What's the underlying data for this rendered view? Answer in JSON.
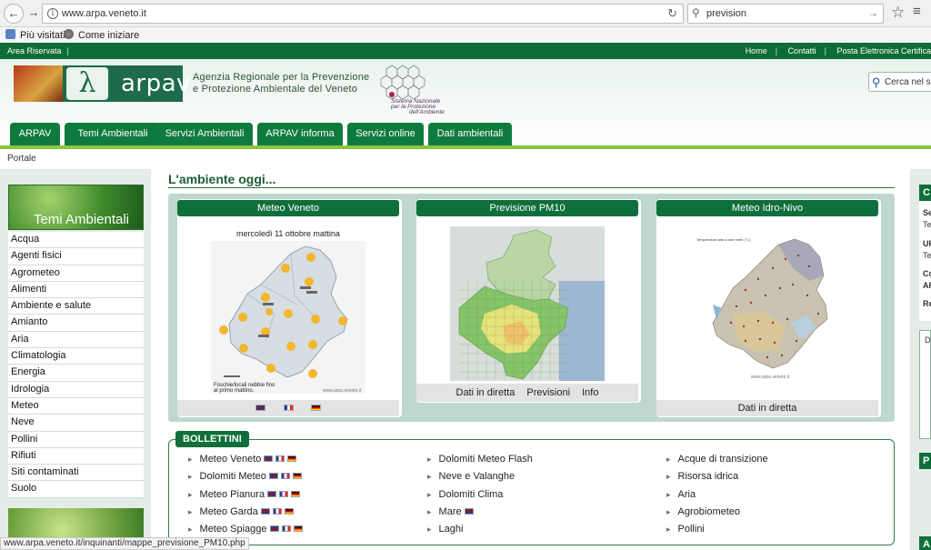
{
  "browser": {
    "url": "www.arpa.veneto.it",
    "search_value": "prevision",
    "bookmarks": [
      "Più visitati",
      "Come iniziare"
    ]
  },
  "topbar": {
    "area": "Area Riservata",
    "links": [
      "Home",
      "Contatti",
      "Posta Elettronica Certifica"
    ]
  },
  "header": {
    "brand": "arpav",
    "agency_line1": "Agenzia Regionale per la Prevenzione",
    "agency_line2": "e Protezione Ambientale del Veneto",
    "snpa_line1": "Sistema Nazionale",
    "snpa_line2": "per la Protezione",
    "snpa_line3": "dell'Ambiente",
    "search_placeholder": "Cerca nel sito"
  },
  "tabs": [
    "ARPAV",
    "Temi Ambientali",
    "Servizi Ambientali",
    "ARPAV informa",
    "Servizi online",
    "Dati ambientali"
  ],
  "breadcrumb": "Portale",
  "sidebar": {
    "banner_title": "Temi Ambientali",
    "items": [
      "Acqua",
      "Agenti fisici",
      "Agrometeo",
      "Alimenti",
      "Ambiente e salute",
      "Amianto",
      "Aria",
      "Climatologia",
      "Energia",
      "Idrologia",
      "Meteo",
      "Neve",
      "Pollini",
      "Rifiuti",
      "Siti contaminati",
      "Suolo"
    ]
  },
  "main": {
    "title": "L'ambiente oggi...",
    "cards": {
      "meteo": {
        "title": "Meteo Veneto",
        "caption": "mercoledì 11 ottobre  mattina",
        "note": "Foschie/locali nebbie fino al primo mattino.",
        "credit": "www.arpa.veneto.it"
      },
      "pm10": {
        "title": "Previsione PM10",
        "links": [
          "Dati in diretta",
          "Previsioni",
          "Info"
        ]
      },
      "idro": {
        "title": "Meteo Idro-Nivo",
        "link": "Dati in diretta",
        "map_title": "Temperatura aria a due metri (°C)",
        "credit": "www.arpa.veneto.it"
      }
    }
  },
  "bollettini": {
    "title": "BOLLETTINI",
    "col1": [
      "Meteo Veneto",
      "Dolomiti Meteo",
      "Meteo Pianura",
      "Meteo Garda",
      "Meteo Spiagge"
    ],
    "col2": [
      "Dolomiti Meteo Flash",
      "Neve e Valanghe",
      "Dolomiti Clima",
      "Mare",
      "Laghi"
    ],
    "col3": [
      "Acque di transizione",
      "Risorsa idrica",
      "Aria",
      "Agrobiometeo",
      "Pollini"
    ]
  },
  "rightcol": {
    "head1": "C",
    "texts": [
      "Se",
      "Te",
      "UR",
      "Te",
      "Co",
      "AF",
      "Re"
    ],
    "tab": "D",
    "head2": "P",
    "head3": "A"
  },
  "status_url": "www.arpa.veneto.it/inquinanti/mappe_previsione_PM10.php",
  "colors": {
    "brand_green": "#0f7a3e",
    "accent_lime": "#8cc63f"
  }
}
